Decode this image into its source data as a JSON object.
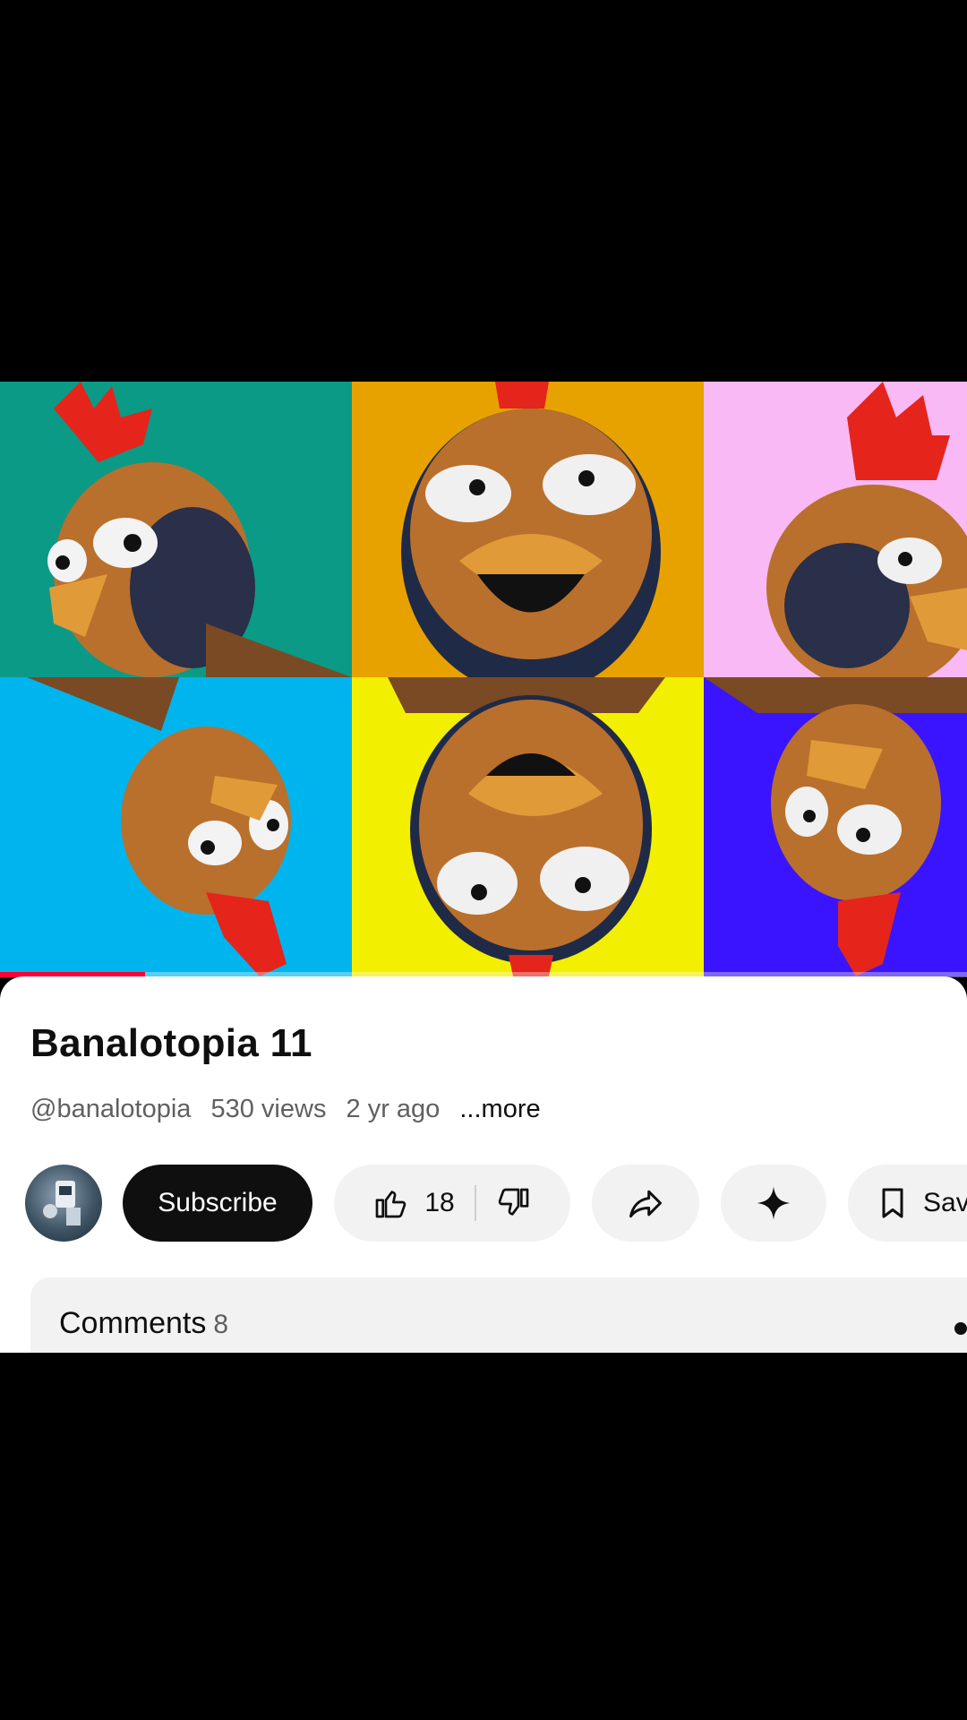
{
  "video": {
    "progress_fraction": 0.15,
    "tiles_colors": [
      "#0b9a86",
      "#e8a200",
      "#f9b9f5",
      "#00b4ee",
      "#f2ef00",
      "#3a14ff"
    ]
  },
  "info": {
    "title": "Banalotopia 11",
    "channel_handle": "@banalotopia",
    "views": "530 views",
    "age": "2 yr ago",
    "more_label": "...more"
  },
  "actions": {
    "subscribe_label": "Subscribe",
    "like_count": "18",
    "save_label": "Save"
  },
  "comments": {
    "label": "Comments",
    "count": "8"
  }
}
